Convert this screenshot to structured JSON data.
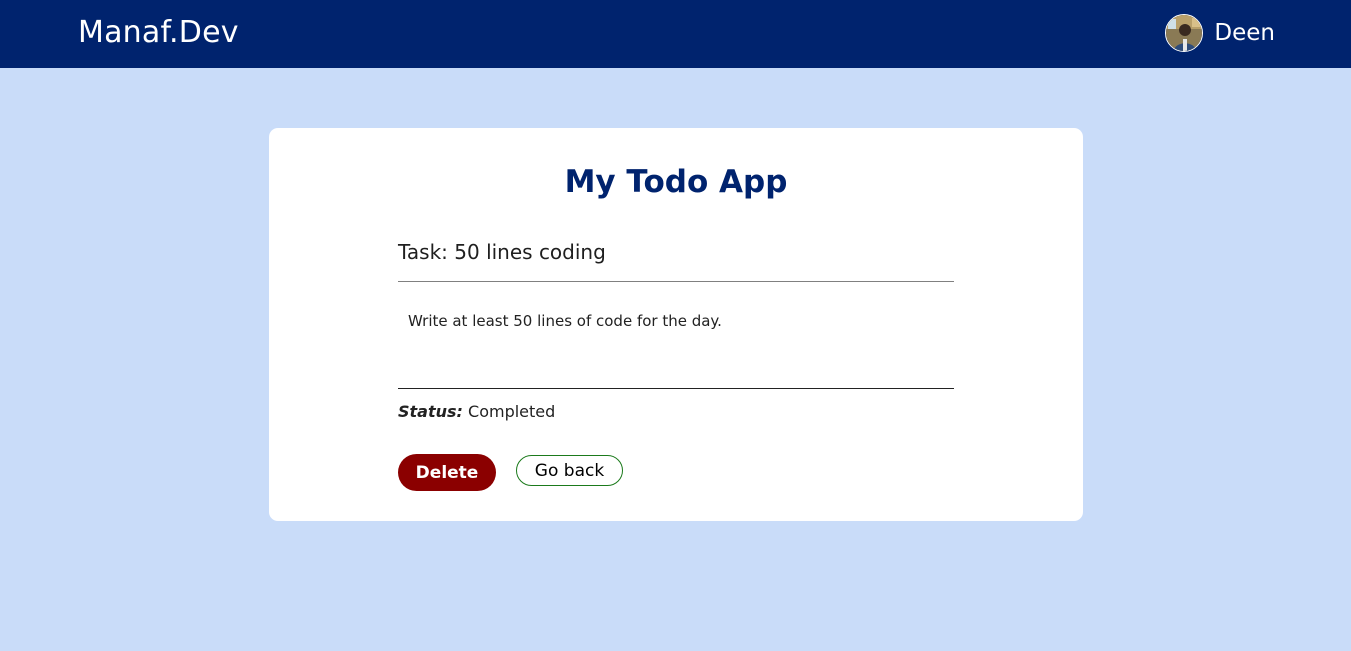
{
  "navbar": {
    "brand": "Manaf.Dev",
    "user_name": "Deen",
    "avatar_icon": "user-avatar-icon",
    "background_color": "#00236e"
  },
  "card": {
    "app_title": "My Todo App",
    "task_title": "Task: 50 lines coding",
    "task_description": "Write at least 50 lines of code for the day.",
    "status_label": "Status:",
    "status_value": "Completed",
    "delete_label": "Delete",
    "back_label": "Go back"
  },
  "colors": {
    "page_background": "#c9dcf9",
    "title": "#00236e",
    "delete_button": "#8b0000",
    "back_button_border": "#1b7a1b"
  }
}
